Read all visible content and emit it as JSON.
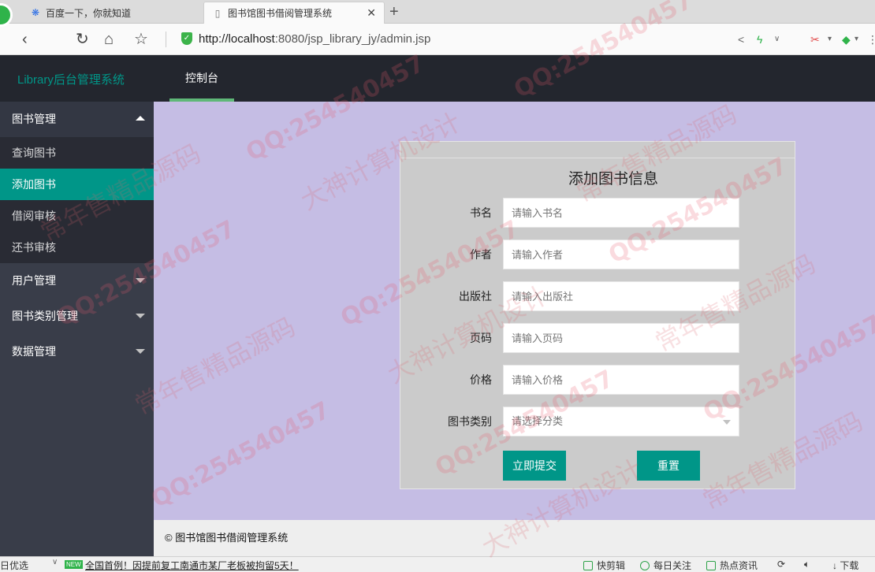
{
  "browser": {
    "tabs": [
      {
        "title": "百度一下，你就知道",
        "favicon": "paw-icon",
        "active": false
      },
      {
        "title": "图书馆图书借阅管理系统",
        "favicon": "page-icon",
        "active": true
      }
    ],
    "url_host": "http://localhost",
    "url_rest": ":8080/jsp_library_jy/admin.jsp"
  },
  "header": {
    "logo": "Library后台管理系统",
    "nav": [
      {
        "label": "控制台"
      }
    ]
  },
  "sidebar": {
    "groups": [
      {
        "label": "图书管理",
        "open": true,
        "items": [
          {
            "label": "查询图书"
          },
          {
            "label": "添加图书",
            "active": true
          },
          {
            "label": "借阅审核"
          },
          {
            "label": "还书审核"
          }
        ]
      },
      {
        "label": "用户管理",
        "open": false
      },
      {
        "label": "图书类别管理",
        "open": false
      },
      {
        "label": "数据管理",
        "open": false
      }
    ]
  },
  "form": {
    "title": "添加图书信息",
    "fields": [
      {
        "label": "书名",
        "placeholder": "请输入书名"
      },
      {
        "label": "作者",
        "placeholder": "请输入作者"
      },
      {
        "label": "出版社",
        "placeholder": "请输入出版社"
      },
      {
        "label": "页码",
        "placeholder": "请输入页码"
      },
      {
        "label": "价格",
        "placeholder": "请输入价格"
      }
    ],
    "category": {
      "label": "图书类别",
      "placeholder": "请选择分类"
    },
    "submit_label": "立即提交",
    "reset_label": "重置"
  },
  "footer": {
    "text": "© 图书馆图书借阅管理系统"
  },
  "statusbar": {
    "left": "日优选",
    "new_badge": "NEW",
    "news": "全国首例！因提前复工南通市某厂老板被拘留5天！",
    "items": [
      "快剪辑",
      "每日关注",
      "热点资讯",
      "",
      "",
      "下载"
    ]
  },
  "watermark": {
    "qq": "QQ:254540457",
    "text_a": "大神计算机设计",
    "text_b": "常年售精品源码"
  },
  "colors": {
    "header_bg": "#23262e",
    "sidebar_bg": "#393d49",
    "accent": "#009688",
    "main_bg": "#c5bde4",
    "panel_bg": "#cbcbcb"
  }
}
